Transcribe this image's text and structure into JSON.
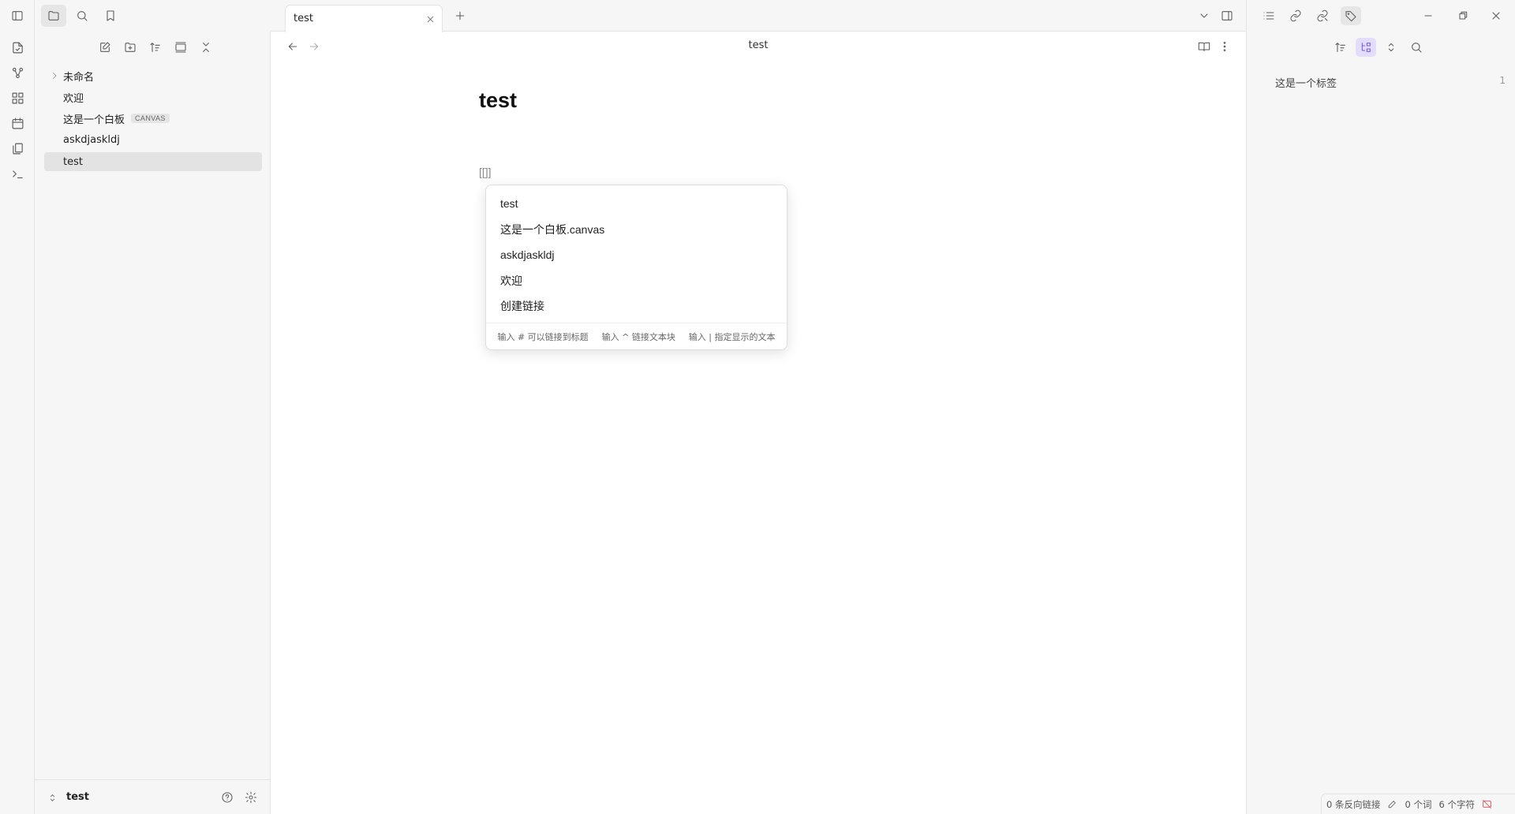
{
  "tab": {
    "title": "test"
  },
  "view": {
    "title": "test"
  },
  "document": {
    "title": "test",
    "content": "[[]]"
  },
  "file_tree": {
    "items": [
      {
        "label": "未命名",
        "type": "folder"
      },
      {
        "label": "欢迎",
        "type": "file"
      },
      {
        "label": "这是一个白板",
        "type": "canvas",
        "badge": "CANVAS"
      },
      {
        "label": "askdjaskldj",
        "type": "file"
      },
      {
        "label": "test",
        "type": "file",
        "active": true
      }
    ]
  },
  "vault": {
    "name": "test"
  },
  "suggestions": {
    "items": [
      "test",
      "这是一个白板.canvas",
      "askdjaskldj",
      "欢迎",
      "创建链接"
    ],
    "footer": [
      "输入 # 可以链接到标题",
      "输入 ^ 链接文本块",
      "输入 | 指定显示的文本"
    ]
  },
  "tags": {
    "items": [
      {
        "label": "这是一个标签",
        "count": "1"
      }
    ]
  },
  "status": {
    "backlinks": "0 条反向链接",
    "words": "0 个词",
    "chars": "6 个字符"
  },
  "colors": {
    "accent": "#7c5cdb",
    "active_bg": "#e3e3e3",
    "sidebar_bg": "#f6f6f6"
  }
}
